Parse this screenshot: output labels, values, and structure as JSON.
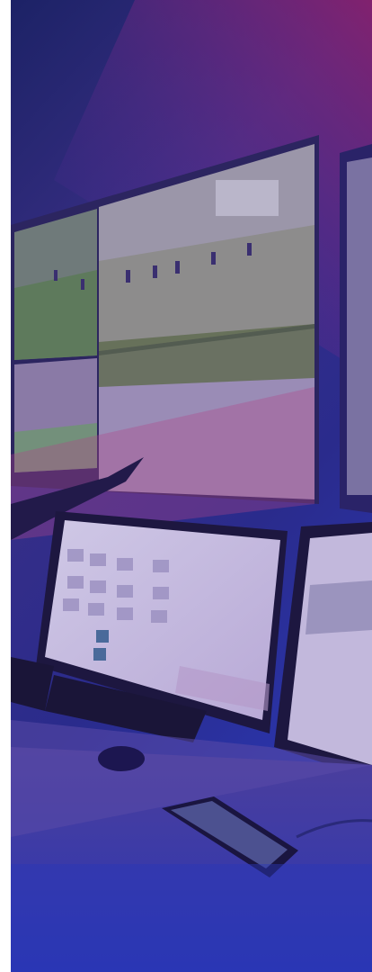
{
  "image": {
    "description_name": "control-room-photo",
    "colors": {
      "overlay_top": "#7a1f6a",
      "overlay_mid": "#3d2a9a",
      "overlay_bottom": "#2430a8",
      "pitch_green": "#5a7a55",
      "screen_light": "#d6d2e8",
      "desk": "#5a4aa8",
      "accent_glow": "#4a6aff"
    }
  }
}
